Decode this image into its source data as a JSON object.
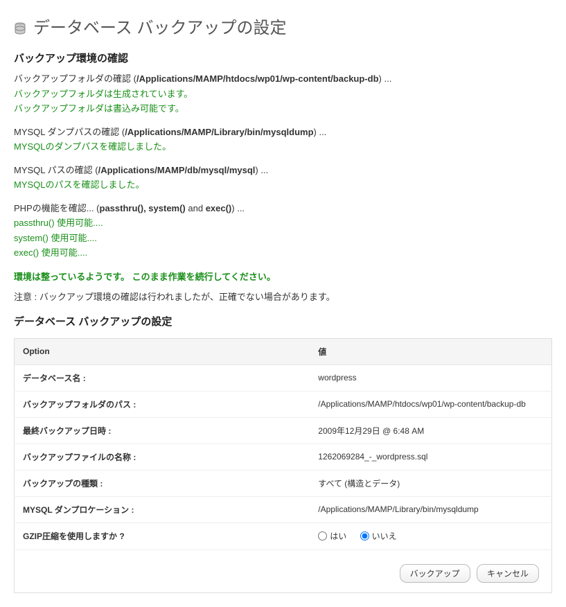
{
  "page_title": "データベース バックアップの設定",
  "section_env_title": "バックアップ環境の確認",
  "env": {
    "folder_check_prefix": "バックアップフォルダの確認 (",
    "folder_path": "/Applications/MAMP/htdocs/wp01/wp-content/backup-db",
    "folder_check_suffix": ") ...",
    "folder_ok1": "バックアップフォルダは生成されています。",
    "folder_ok2": "バックアップフォルダは書込み可能です。",
    "dump_check_prefix": "MYSQL ダンプパスの確認 (",
    "dump_path": "/Applications/MAMP/Library/bin/mysqldump",
    "dump_check_suffix": ") ...",
    "dump_ok": "MYSQLのダンプパスを確認しました。",
    "mysql_check_prefix": "MYSQL パスの確認 (",
    "mysql_path": "/Applications/MAMP/db/mysql/mysql",
    "mysql_check_suffix": ") ...",
    "mysql_ok": "MYSQLのパスを確認しました。",
    "php_check_prefix": "PHPの機能を確認... (",
    "php_funcs": "passthru(), system()",
    "php_and": " and ",
    "php_exec": "exec()",
    "php_check_suffix": ") ...",
    "passthru_ok": "passthru() 使用可能....",
    "system_ok": "system() 使用可能....",
    "exec_ok": "exec() 使用可能....",
    "summary": "環境は整っているようです。 このまま作業を続行してください。",
    "note": "注意 : バックアップ環境の確認は行われましたが、正確でない場合があります。"
  },
  "section_settings_title": "データベース バックアップの設定",
  "table": {
    "header_option": "Option",
    "header_value": "値",
    "rows": [
      {
        "label": "データベース名 :",
        "value": "wordpress"
      },
      {
        "label": "バックアップフォルダのパス :",
        "value": "/Applications/MAMP/htdocs/wp01/wp-content/backup-db"
      },
      {
        "label": "最終バックアップ日時 :",
        "value": "2009年12月29日 @ 6:48 AM"
      },
      {
        "label": "バックアップファイルの名称 :",
        "value": "1262069284_-_wordpress.sql"
      },
      {
        "label": "バックアップの種類 :",
        "value": "すべて (構造とデータ)"
      },
      {
        "label": "MYSQL ダンプロケーション :",
        "value": "/Applications/MAMP/Library/bin/mysqldump"
      }
    ],
    "gzip_label": "GZIP圧縮を使用しますか ?",
    "gzip_yes": "はい",
    "gzip_no": "いいえ",
    "gzip_selected": "no"
  },
  "buttons": {
    "backup": "バックアップ",
    "cancel": "キャンセル"
  }
}
